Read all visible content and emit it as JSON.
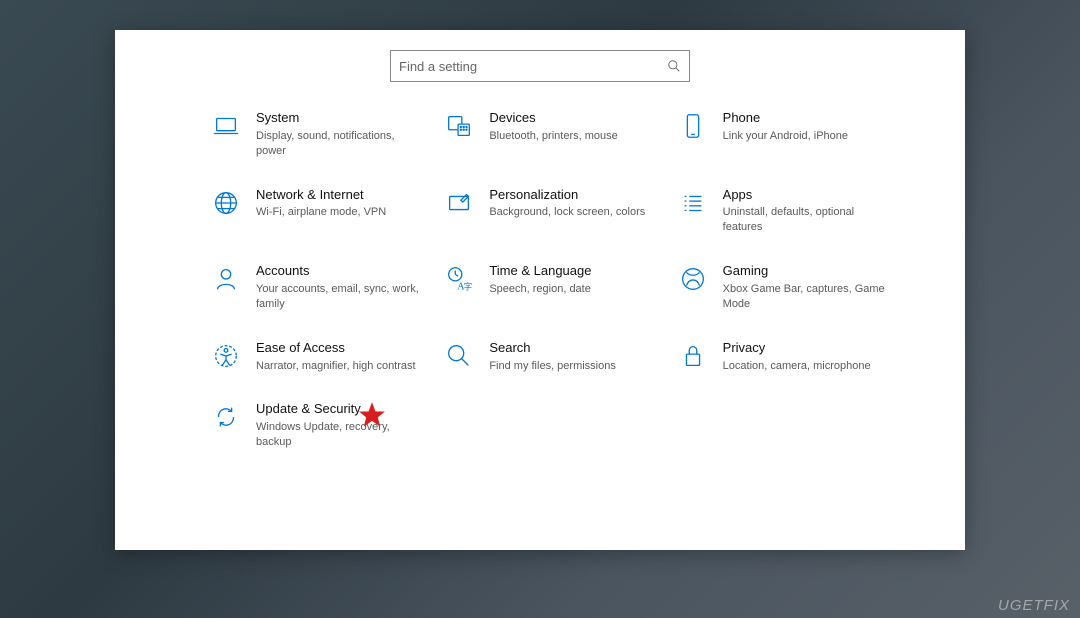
{
  "search": {
    "placeholder": "Find a setting"
  },
  "watermark": "UGETFIX",
  "categories": [
    {
      "key": "system",
      "title": "System",
      "desc": "Display, sound, notifications, power"
    },
    {
      "key": "devices",
      "title": "Devices",
      "desc": "Bluetooth, printers, mouse"
    },
    {
      "key": "phone",
      "title": "Phone",
      "desc": "Link your Android, iPhone"
    },
    {
      "key": "network",
      "title": "Network & Internet",
      "desc": "Wi-Fi, airplane mode, VPN"
    },
    {
      "key": "personalization",
      "title": "Personalization",
      "desc": "Background, lock screen, colors"
    },
    {
      "key": "apps",
      "title": "Apps",
      "desc": "Uninstall, defaults, optional features"
    },
    {
      "key": "accounts",
      "title": "Accounts",
      "desc": "Your accounts, email, sync, work, family"
    },
    {
      "key": "time",
      "title": "Time & Language",
      "desc": "Speech, region, date"
    },
    {
      "key": "gaming",
      "title": "Gaming",
      "desc": "Xbox Game Bar, captures, Game Mode"
    },
    {
      "key": "ease",
      "title": "Ease of Access",
      "desc": "Narrator, magnifier, high contrast"
    },
    {
      "key": "search",
      "title": "Search",
      "desc": "Find my files, permissions"
    },
    {
      "key": "privacy",
      "title": "Privacy",
      "desc": "Location, camera, microphone"
    },
    {
      "key": "update",
      "title": "Update & Security",
      "desc": "Windows Update, recovery, backup"
    }
  ]
}
